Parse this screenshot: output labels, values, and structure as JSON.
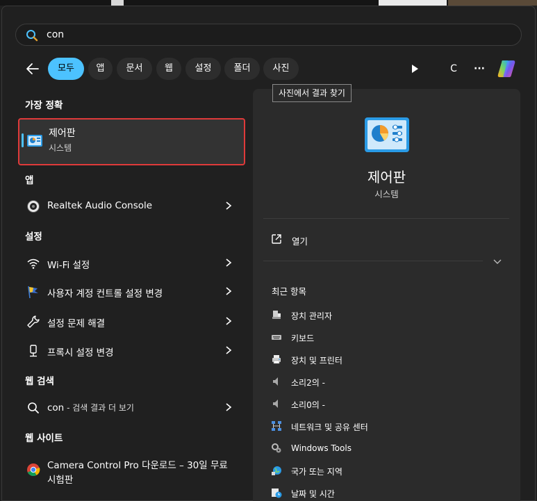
{
  "search": {
    "value": "con"
  },
  "filters": [
    {
      "label": "모두",
      "active": true
    },
    {
      "label": "앱"
    },
    {
      "label": "문서"
    },
    {
      "label": "웹"
    },
    {
      "label": "설정"
    },
    {
      "label": "폴더"
    },
    {
      "label": "사진"
    }
  ],
  "toolbar": {
    "user_initial": "C",
    "more_label": "···"
  },
  "tooltip": "사진에서 결과 찾기",
  "sections": {
    "best": "가장 정확",
    "apps": "앱",
    "settings": "설정",
    "web_search": "웹 검색",
    "websites": "웹 사이트"
  },
  "best_match": {
    "title": "제어판",
    "subtitle": "시스템"
  },
  "apps": [
    {
      "label": "Realtek Audio Console",
      "icon": "speaker-dial-icon"
    }
  ],
  "settings": [
    {
      "label": "Wi-Fi 설정",
      "icon": "wifi-icon"
    },
    {
      "label": "사용자 계정 컨트롤 설정 변경",
      "icon": "flag-icon"
    },
    {
      "label": "설정 문제 해결",
      "icon": "wrench-icon"
    },
    {
      "label": "프록시 설정 변경",
      "icon": "proxy-icon"
    }
  ],
  "web_search": {
    "query": "con",
    "suffix": " - 검색 결과 더 보기"
  },
  "websites": [
    {
      "line1": "Camera Control Pro 다운로드 – 30일 무료",
      "line2": "시험판",
      "icon": "chrome-icon"
    }
  ],
  "details": {
    "title": "제어판",
    "subtitle": "시스템",
    "open_label": "열기",
    "recent_header": "최근 항목",
    "recent": [
      {
        "label": "장치 관리자",
        "icon": "device-manager-icon"
      },
      {
        "label": "키보드",
        "icon": "keyboard-icon"
      },
      {
        "label": "장치 및 프린터",
        "icon": "printer-icon"
      },
      {
        "label": "소리2의 -",
        "icon": "sound-icon"
      },
      {
        "label": "소리0의 -",
        "icon": "sound-icon"
      },
      {
        "label": "네트워크 및 공유 센터",
        "icon": "network-icon"
      },
      {
        "label": "Windows Tools",
        "icon": "tools-icon"
      },
      {
        "label": "국가 또는 지역",
        "icon": "globe-icon"
      },
      {
        "label": "날짜 및 시간",
        "icon": "clock-icon"
      }
    ]
  },
  "colors": {
    "accent": "#4cc2ff",
    "highlight_border": "#e03a3a",
    "background": "#202020",
    "details_bg": "#2b2b2b"
  }
}
